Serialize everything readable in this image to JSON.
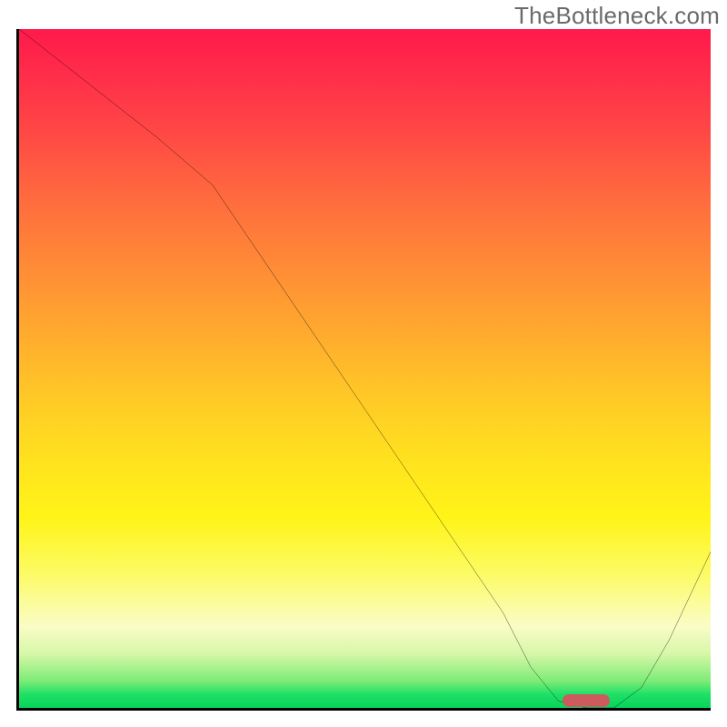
{
  "watermark": "TheBottleneck.com",
  "chart_data": {
    "type": "line",
    "title": "",
    "xlabel": "",
    "ylabel": "",
    "xlim": [
      0,
      100
    ],
    "ylim": [
      0,
      100
    ],
    "x": [
      0,
      10,
      20,
      28,
      40,
      50,
      60,
      70,
      74,
      78,
      82,
      86,
      90,
      94,
      100
    ],
    "values": [
      100,
      92,
      84,
      77,
      59,
      44,
      29,
      14,
      6,
      1,
      0,
      0,
      3,
      10,
      23
    ],
    "optimal_marker": {
      "x": 82,
      "y": 0
    },
    "gradient_note": "background encodes bottleneck severity: red=high, green=optimal"
  }
}
